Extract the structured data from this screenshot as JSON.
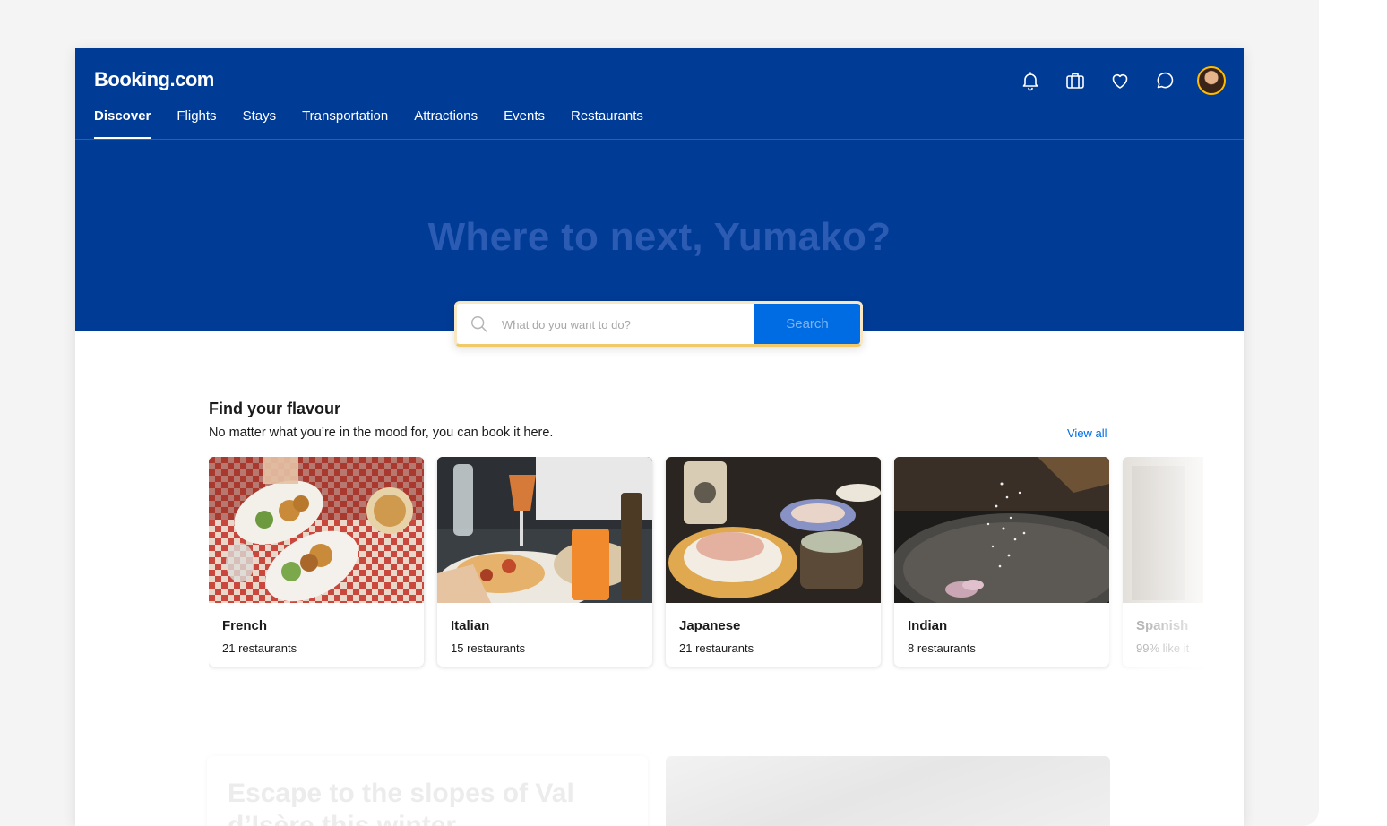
{
  "header": {
    "logo": "Booking.com",
    "nav": [
      {
        "label": "Discover",
        "active": true
      },
      {
        "label": "Flights"
      },
      {
        "label": "Stays"
      },
      {
        "label": "Transportation"
      },
      {
        "label": "Attractions"
      },
      {
        "label": "Events"
      },
      {
        "label": "Restaurants"
      }
    ],
    "icons": [
      "bell-icon",
      "suitcase-icon",
      "heart-icon",
      "chat-icon",
      "avatar"
    ]
  },
  "hero": {
    "title": "Where to next, Yumako?",
    "search_placeholder": "What do you want to do?",
    "search_button": "Search"
  },
  "flavour": {
    "title": "Find your flavour",
    "subtitle": "No matter what you’re in the mood for, you can book it here.",
    "view_all": "View all",
    "cards": [
      {
        "name": "French",
        "count": "21 restaurants"
      },
      {
        "name": "Italian",
        "count": "15 restaurants"
      },
      {
        "name": "Japanese",
        "count": "21 restaurants"
      },
      {
        "name": "Indian",
        "count": "8 restaurants"
      },
      {
        "name": "Spanish",
        "count": "99% like it"
      }
    ]
  },
  "promo": {
    "title": "Escape to the slopes of Val d’Isère this winter"
  },
  "colors": {
    "brand_blue": "#003b95",
    "action_blue": "#006ce4",
    "accent_yellow": "#febb02"
  }
}
